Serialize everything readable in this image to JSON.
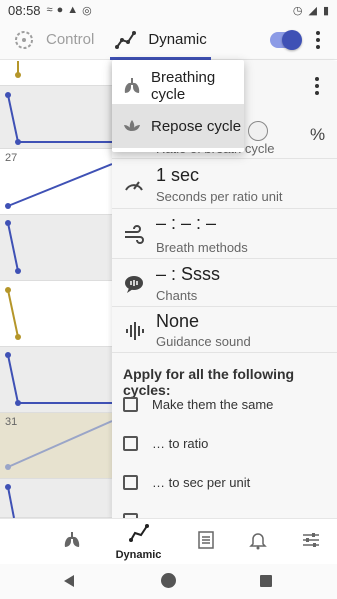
{
  "status_bar": {
    "time": "08:58"
  },
  "tabs": {
    "control": "Control",
    "dynamic": "Dynamic"
  },
  "graph": {
    "labels": [
      "27",
      "31"
    ]
  },
  "panel": {
    "cut_sub": "Ratio of breath cycle",
    "speed": {
      "value": "1 sec",
      "label": "Seconds per ratio unit"
    },
    "methods": {
      "value": "– : – : –",
      "label": "Breath methods"
    },
    "chants": {
      "value": "– : Ssss",
      "label": "Chants"
    },
    "guidance": {
      "value": "None",
      "label": "Guidance sound"
    },
    "apply_title": "Apply for all the following cycles:",
    "checkboxes": [
      "Make them the same",
      "… to ratio",
      "… to sec per unit"
    ]
  },
  "menu": {
    "items": [
      {
        "label": "Breathing cycle",
        "icon": "lungs-icon"
      },
      {
        "label": "Repose cycle",
        "icon": "lotus-icon"
      }
    ]
  },
  "bottom_nav": {
    "dynamic": "Dynamic"
  },
  "colors": {
    "accent": "#3f51b5",
    "line_blue": "#3f51b5",
    "line_gold": "#b5962a",
    "line_gray": "#9aa5c8",
    "highlight_cell": "#e7e2cf"
  }
}
